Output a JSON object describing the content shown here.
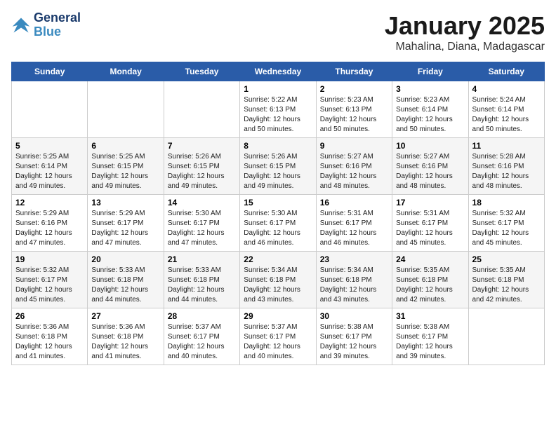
{
  "logo": {
    "line1": "General",
    "line2": "Blue"
  },
  "title": "January 2025",
  "subtitle": "Mahalina, Diana, Madagascar",
  "days_header": [
    "Sunday",
    "Monday",
    "Tuesday",
    "Wednesday",
    "Thursday",
    "Friday",
    "Saturday"
  ],
  "weeks": [
    [
      {
        "day": "",
        "info": ""
      },
      {
        "day": "",
        "info": ""
      },
      {
        "day": "",
        "info": ""
      },
      {
        "day": "1",
        "info": "Sunrise: 5:22 AM\nSunset: 6:13 PM\nDaylight: 12 hours\nand 50 minutes."
      },
      {
        "day": "2",
        "info": "Sunrise: 5:23 AM\nSunset: 6:13 PM\nDaylight: 12 hours\nand 50 minutes."
      },
      {
        "day": "3",
        "info": "Sunrise: 5:23 AM\nSunset: 6:14 PM\nDaylight: 12 hours\nand 50 minutes."
      },
      {
        "day": "4",
        "info": "Sunrise: 5:24 AM\nSunset: 6:14 PM\nDaylight: 12 hours\nand 50 minutes."
      }
    ],
    [
      {
        "day": "5",
        "info": "Sunrise: 5:25 AM\nSunset: 6:14 PM\nDaylight: 12 hours\nand 49 minutes."
      },
      {
        "day": "6",
        "info": "Sunrise: 5:25 AM\nSunset: 6:15 PM\nDaylight: 12 hours\nand 49 minutes."
      },
      {
        "day": "7",
        "info": "Sunrise: 5:26 AM\nSunset: 6:15 PM\nDaylight: 12 hours\nand 49 minutes."
      },
      {
        "day": "8",
        "info": "Sunrise: 5:26 AM\nSunset: 6:15 PM\nDaylight: 12 hours\nand 49 minutes."
      },
      {
        "day": "9",
        "info": "Sunrise: 5:27 AM\nSunset: 6:16 PM\nDaylight: 12 hours\nand 48 minutes."
      },
      {
        "day": "10",
        "info": "Sunrise: 5:27 AM\nSunset: 6:16 PM\nDaylight: 12 hours\nand 48 minutes."
      },
      {
        "day": "11",
        "info": "Sunrise: 5:28 AM\nSunset: 6:16 PM\nDaylight: 12 hours\nand 48 minutes."
      }
    ],
    [
      {
        "day": "12",
        "info": "Sunrise: 5:29 AM\nSunset: 6:16 PM\nDaylight: 12 hours\nand 47 minutes."
      },
      {
        "day": "13",
        "info": "Sunrise: 5:29 AM\nSunset: 6:17 PM\nDaylight: 12 hours\nand 47 minutes."
      },
      {
        "day": "14",
        "info": "Sunrise: 5:30 AM\nSunset: 6:17 PM\nDaylight: 12 hours\nand 47 minutes."
      },
      {
        "day": "15",
        "info": "Sunrise: 5:30 AM\nSunset: 6:17 PM\nDaylight: 12 hours\nand 46 minutes."
      },
      {
        "day": "16",
        "info": "Sunrise: 5:31 AM\nSunset: 6:17 PM\nDaylight: 12 hours\nand 46 minutes."
      },
      {
        "day": "17",
        "info": "Sunrise: 5:31 AM\nSunset: 6:17 PM\nDaylight: 12 hours\nand 45 minutes."
      },
      {
        "day": "18",
        "info": "Sunrise: 5:32 AM\nSunset: 6:17 PM\nDaylight: 12 hours\nand 45 minutes."
      }
    ],
    [
      {
        "day": "19",
        "info": "Sunrise: 5:32 AM\nSunset: 6:17 PM\nDaylight: 12 hours\nand 45 minutes."
      },
      {
        "day": "20",
        "info": "Sunrise: 5:33 AM\nSunset: 6:18 PM\nDaylight: 12 hours\nand 44 minutes."
      },
      {
        "day": "21",
        "info": "Sunrise: 5:33 AM\nSunset: 6:18 PM\nDaylight: 12 hours\nand 44 minutes."
      },
      {
        "day": "22",
        "info": "Sunrise: 5:34 AM\nSunset: 6:18 PM\nDaylight: 12 hours\nand 43 minutes."
      },
      {
        "day": "23",
        "info": "Sunrise: 5:34 AM\nSunset: 6:18 PM\nDaylight: 12 hours\nand 43 minutes."
      },
      {
        "day": "24",
        "info": "Sunrise: 5:35 AM\nSunset: 6:18 PM\nDaylight: 12 hours\nand 42 minutes."
      },
      {
        "day": "25",
        "info": "Sunrise: 5:35 AM\nSunset: 6:18 PM\nDaylight: 12 hours\nand 42 minutes."
      }
    ],
    [
      {
        "day": "26",
        "info": "Sunrise: 5:36 AM\nSunset: 6:18 PM\nDaylight: 12 hours\nand 41 minutes."
      },
      {
        "day": "27",
        "info": "Sunrise: 5:36 AM\nSunset: 6:18 PM\nDaylight: 12 hours\nand 41 minutes."
      },
      {
        "day": "28",
        "info": "Sunrise: 5:37 AM\nSunset: 6:17 PM\nDaylight: 12 hours\nand 40 minutes."
      },
      {
        "day": "29",
        "info": "Sunrise: 5:37 AM\nSunset: 6:17 PM\nDaylight: 12 hours\nand 40 minutes."
      },
      {
        "day": "30",
        "info": "Sunrise: 5:38 AM\nSunset: 6:17 PM\nDaylight: 12 hours\nand 39 minutes."
      },
      {
        "day": "31",
        "info": "Sunrise: 5:38 AM\nSunset: 6:17 PM\nDaylight: 12 hours\nand 39 minutes."
      },
      {
        "day": "",
        "info": ""
      }
    ]
  ]
}
